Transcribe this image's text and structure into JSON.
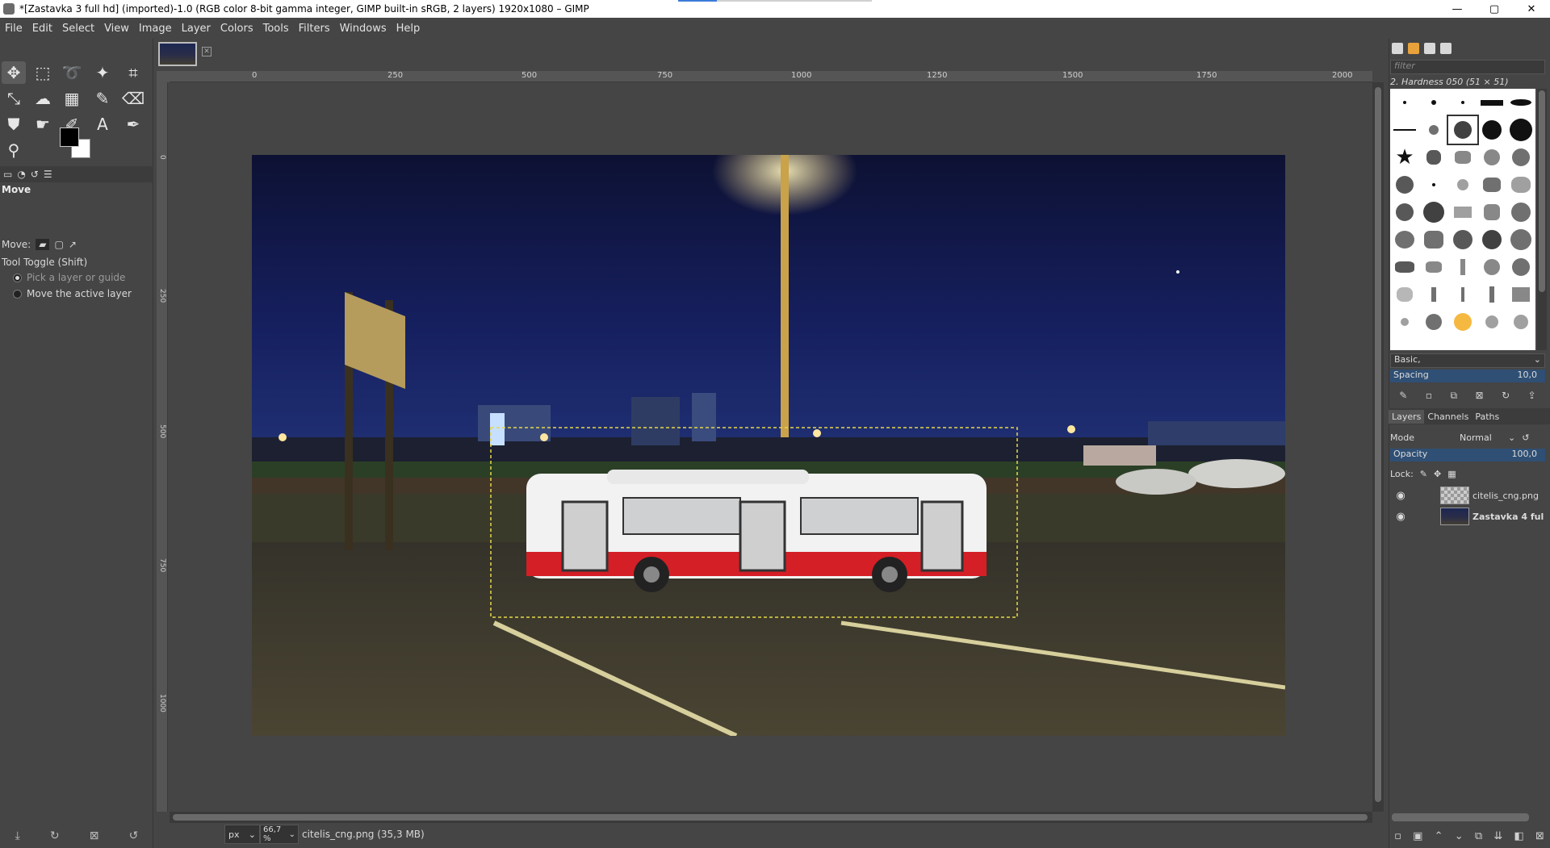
{
  "window": {
    "title": "*[Zastavka 3 full hd] (imported)-1.0 (RGB color 8-bit gamma integer, GIMP built-in sRGB, 2 layers) 1920x1080 – GIMP",
    "minimize": "—",
    "maximize": "▢",
    "close": "✕"
  },
  "menu": [
    "File",
    "Edit",
    "Select",
    "View",
    "Image",
    "Layer",
    "Colors",
    "Tools",
    "Filters",
    "Windows",
    "Help"
  ],
  "tool_options": {
    "title": "Move",
    "move_label": "Move:",
    "toggle_label": "Tool Toggle  (Shift)",
    "option1": "Pick a layer or guide",
    "option2": "Move the active layer"
  },
  "ruler": {
    "h_labels": [
      "0",
      "250",
      "500",
      "750",
      "1000",
      "1250",
      "1500",
      "1750",
      "2000"
    ],
    "v_labels": [
      "0",
      "250",
      "500",
      "750",
      "1000"
    ]
  },
  "status": {
    "unit": "px",
    "zoom": "66,7 %",
    "text": "citelis_cng.png (35,3 MB)"
  },
  "brushes": {
    "filter_placeholder": "filter",
    "selected_name": "2. Hardness 050 (51 × 51)",
    "preset": "Basic,",
    "spacing_label": "Spacing",
    "spacing_value": "10,0"
  },
  "layers_panel": {
    "tabs": [
      "Layers",
      "Channels",
      "Paths"
    ],
    "mode_label": "Mode",
    "mode_value": "Normal",
    "opacity_label": "Opacity",
    "opacity_value": "100,0",
    "lock_label": "Lock:",
    "layers": [
      {
        "name": "citelis_cng.png",
        "visible": true
      },
      {
        "name": "Zastavka 4 ful",
        "visible": true
      }
    ]
  },
  "colors": {
    "foreground": "#000000",
    "background": "#ffffff",
    "selection": "#e6d84a"
  },
  "icons": {
    "eye": "eye-icon",
    "move": "move-tool-icon",
    "text": "text-tool-icon"
  }
}
